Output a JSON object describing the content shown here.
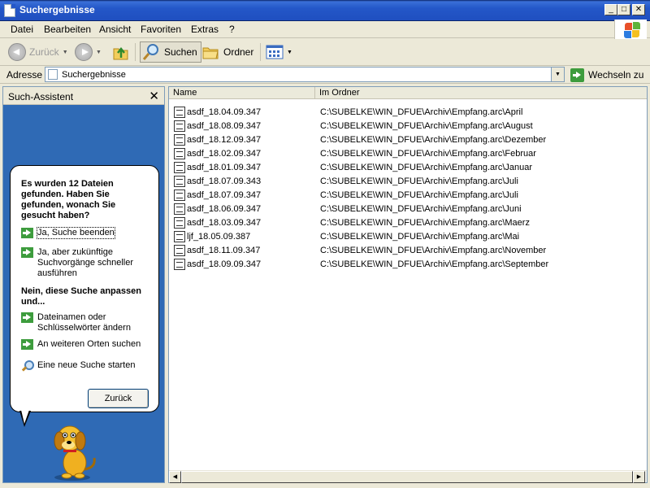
{
  "window": {
    "title": "Suchergebnisse"
  },
  "menu": [
    "Datei",
    "Bearbeiten",
    "Ansicht",
    "Favoriten",
    "Extras",
    "?"
  ],
  "toolbar": {
    "back": "Zurück",
    "search": "Suchen",
    "folders": "Ordner"
  },
  "address": {
    "label": "Adresse",
    "value": "Suchergebnisse",
    "go": "Wechseln zu"
  },
  "assistant": {
    "title": "Such-Assistent",
    "question": "Es wurden 12 Dateien gefunden. Haben Sie gefunden, wonach Sie gesucht haben?",
    "yes_finish": "Ja, Suche beenden",
    "yes_faster": "Ja, aber zukünftige Suchvorgänge schneller ausführen",
    "adjust": "Nein, diese Suche anpassen und...",
    "names_keywords": "Dateinamen oder Schlüsselwörter ändern",
    "other_places": "An weiteren Orten suchen",
    "new_search": "Eine neue Suche starten",
    "back_button": "Zurück"
  },
  "columns": {
    "name": "Name",
    "folder": "Im Ordner"
  },
  "files": [
    {
      "name": "asdf_18.04.09.347",
      "folder": "C:\\SUBELKE\\WIN_DFUE\\Archiv\\Empfang.arc\\April"
    },
    {
      "name": "asdf_18.08.09.347",
      "folder": "C:\\SUBELKE\\WIN_DFUE\\Archiv\\Empfang.arc\\August"
    },
    {
      "name": "asdf_18.12.09.347",
      "folder": "C:\\SUBELKE\\WIN_DFUE\\Archiv\\Empfang.arc\\Dezember"
    },
    {
      "name": "asdf_18.02.09.347",
      "folder": "C:\\SUBELKE\\WIN_DFUE\\Archiv\\Empfang.arc\\Februar"
    },
    {
      "name": "asdf_18.01.09.347",
      "folder": "C:\\SUBELKE\\WIN_DFUE\\Archiv\\Empfang.arc\\Januar"
    },
    {
      "name": "asdf_18.07.09.343",
      "folder": "C:\\SUBELKE\\WIN_DFUE\\Archiv\\Empfang.arc\\Juli"
    },
    {
      "name": "asdf_18.07.09.347",
      "folder": "C:\\SUBELKE\\WIN_DFUE\\Archiv\\Empfang.arc\\Juli"
    },
    {
      "name": "asdf_18.06.09.347",
      "folder": "C:\\SUBELKE\\WIN_DFUE\\Archiv\\Empfang.arc\\Juni"
    },
    {
      "name": "asdf_18.03.09.347",
      "folder": "C:\\SUBELKE\\WIN_DFUE\\Archiv\\Empfang.arc\\Maerz"
    },
    {
      "name": "ljf_18.05.09.387",
      "folder": "C:\\SUBELKE\\WIN_DFUE\\Archiv\\Empfang.arc\\Mai"
    },
    {
      "name": "asdf_18.11.09.347",
      "folder": "C:\\SUBELKE\\WIN_DFUE\\Archiv\\Empfang.arc\\November"
    },
    {
      "name": "asdf_18.09.09.347",
      "folder": "C:\\SUBELKE\\WIN_DFUE\\Archiv\\Empfang.arc\\September"
    }
  ]
}
